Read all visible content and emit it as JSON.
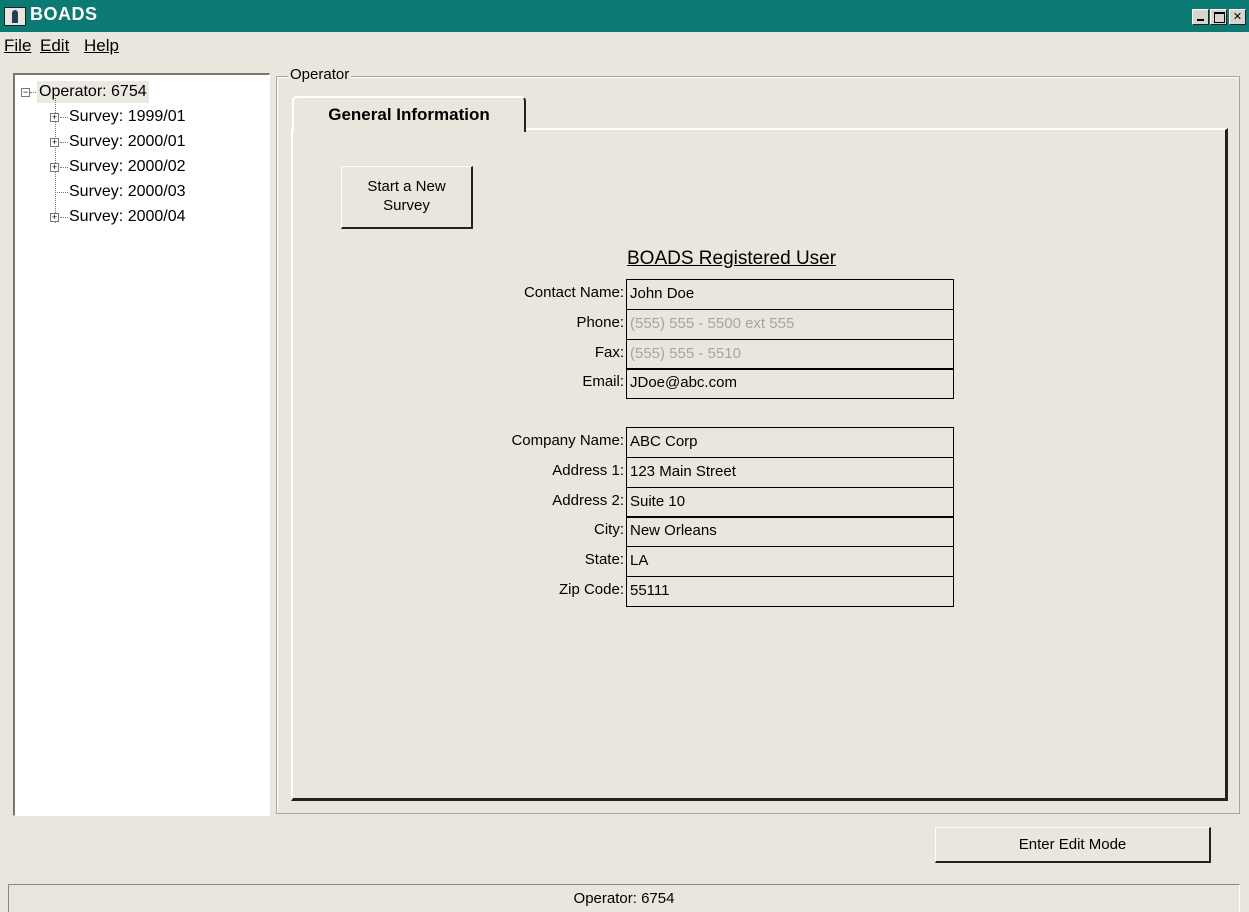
{
  "window": {
    "title": "BOADS"
  },
  "menu": {
    "file": "File",
    "edit": "Edit",
    "help": "Help"
  },
  "tree": {
    "root": "Operator: 6754",
    "items": [
      {
        "label": "Survey: 1999/01",
        "expandable": true
      },
      {
        "label": "Survey: 2000/01",
        "expandable": true
      },
      {
        "label": "Survey: 2000/02",
        "expandable": true
      },
      {
        "label": "Survey: 2000/03",
        "expandable": false
      },
      {
        "label": "Survey: 2000/04",
        "expandable": true
      }
    ]
  },
  "group": {
    "legend": "Operator"
  },
  "tabs": {
    "general": "General Information"
  },
  "buttons": {
    "new_survey": "Start a New\nSurvey",
    "edit_mode": "Enter Edit Mode"
  },
  "form": {
    "title": "BOADS Registered User",
    "contact": {
      "name_label": "Contact Name:",
      "name": "John Doe",
      "phone_label": "Phone:",
      "phone": "(555) 555 - 5500 ext 555",
      "fax_label": "Fax:",
      "fax": "(555) 555 - 5510",
      "email_label": "Email:",
      "email": "JDoe@abc.com"
    },
    "company": {
      "name_label": "Company Name:",
      "name": "ABC Corp",
      "address1_label": "Address 1:",
      "address1": "123 Main Street",
      "address2_label": "Address 2:",
      "address2": "Suite 10",
      "city_label": "City:",
      "city": "New Orleans",
      "state_label": "State:",
      "state": "LA",
      "zip_label": "Zip Code:",
      "zip": "55111"
    }
  },
  "status": {
    "text": "Operator: 6754"
  },
  "colors": {
    "titlebar": "#0b7a73",
    "background": "#e9e6de",
    "dim_text": "#a8a59a"
  }
}
